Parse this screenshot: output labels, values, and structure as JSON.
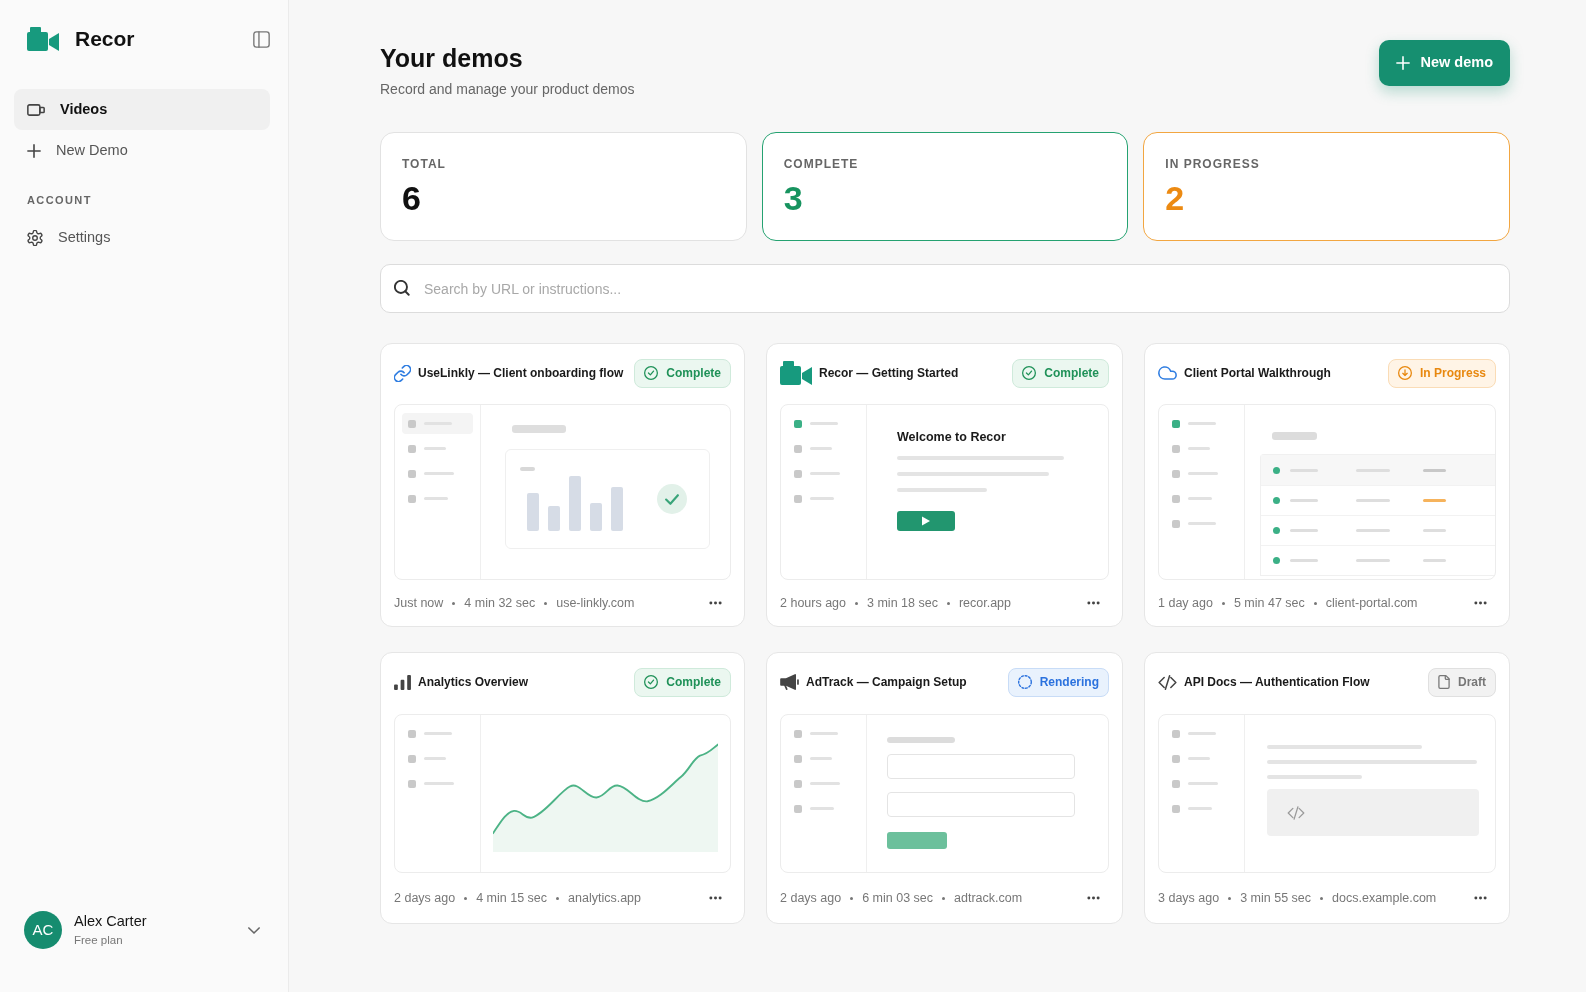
{
  "sidebar": {
    "brand": "Recor",
    "nav": [
      {
        "label": "Videos",
        "selected": true
      },
      {
        "label": "New Demo",
        "selected": false
      }
    ],
    "sections": [
      {
        "heading": "ACCOUNT",
        "items": [
          {
            "label": "Settings",
            "selected": false
          }
        ]
      }
    ],
    "user": {
      "initials": "AC",
      "name": "Alex Carter",
      "plan": "Free plan"
    }
  },
  "header": {
    "title": "Your demos",
    "subtitle": "Record and manage your product demos",
    "action": "New demo"
  },
  "stats": [
    {
      "kind": "total",
      "label": "TOTAL",
      "value": "6"
    },
    {
      "kind": "complete",
      "label": "COMPLETE",
      "value": "3"
    },
    {
      "kind": "in_progress",
      "label": "IN PROGRESS",
      "value": "2"
    }
  ],
  "search": {
    "placeholder": "Search by URL or instructions..."
  },
  "demos": [
    {
      "title": "UseLinkly — Client onboarding flow",
      "status": {
        "kind": "complete",
        "label": "Complete"
      },
      "preview": {
        "kind": "bar_chart"
      },
      "time": "Just now",
      "duration": "4 min 32 sec",
      "domain": "use-linkly.com"
    },
    {
      "title": "Recor — Getting Started",
      "status": {
        "kind": "complete",
        "label": "Complete"
      },
      "preview": {
        "kind": "welcome",
        "heading": "Welcome to Recor"
      },
      "time": "2 hours ago",
      "duration": "3 min 18 sec",
      "domain": "recor.app"
    },
    {
      "title": "Client Portal Walkthrough",
      "status": {
        "kind": "in_progress",
        "label": "In Progress"
      },
      "preview": {
        "kind": "table"
      },
      "time": "1 day ago",
      "duration": "5 min 47 sec",
      "domain": "client-portal.com"
    },
    {
      "title": "Analytics Overview",
      "status": {
        "kind": "complete",
        "label": "Complete"
      },
      "preview": {
        "kind": "line_chart"
      },
      "time": "2 days ago",
      "duration": "4 min 15 sec",
      "domain": "analytics.app"
    },
    {
      "title": "AdTrack — Campaign Setup",
      "status": {
        "kind": "rendering",
        "label": "Rendering"
      },
      "preview": {
        "kind": "form"
      },
      "time": "2 days ago",
      "duration": "6 min 03 sec",
      "domain": "adtrack.com"
    },
    {
      "title": "API Docs — Authentication Flow",
      "status": {
        "kind": "draft",
        "label": "Draft"
      },
      "preview": {
        "kind": "code"
      },
      "time": "3 days ago",
      "duration": "3 min 55 sec",
      "domain": "docs.example.com"
    }
  ]
}
